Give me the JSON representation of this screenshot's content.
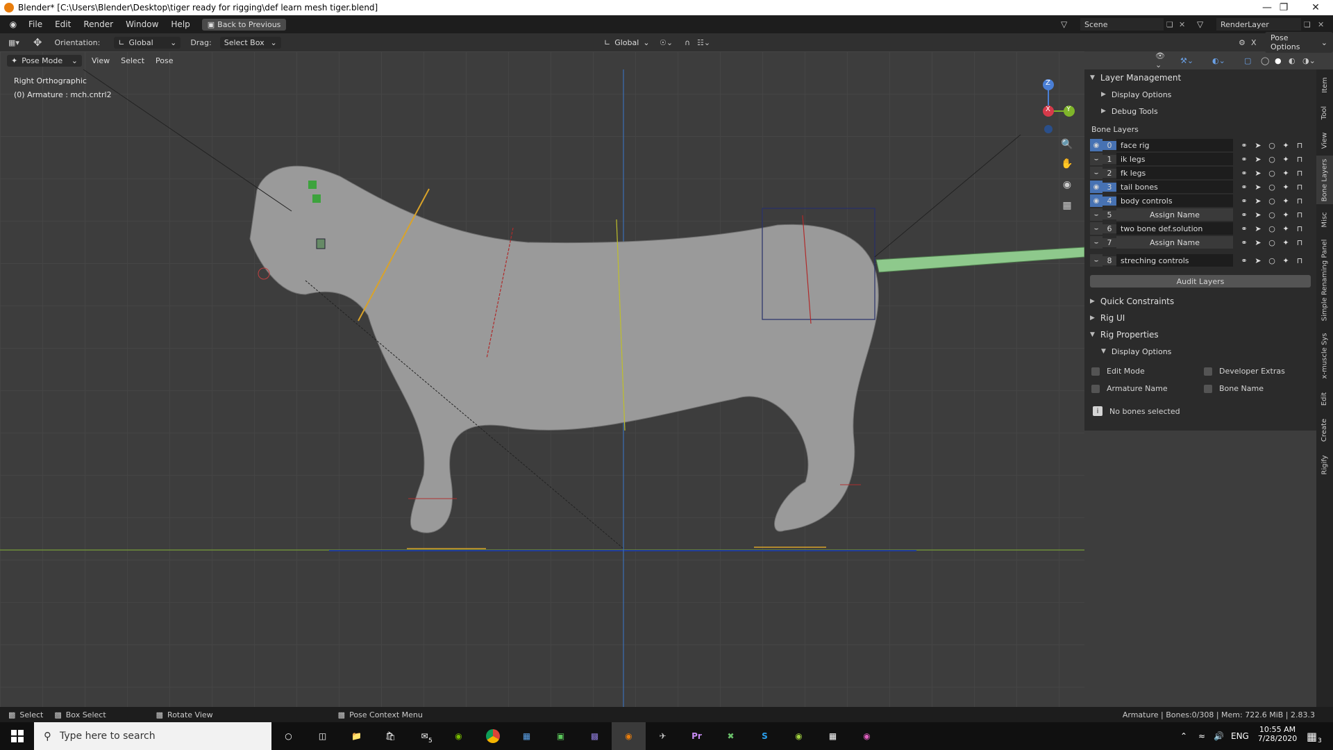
{
  "window": {
    "title": "Blender* [C:\\Users\\Blender\\Desktop\\tiger ready for rigging\\def learn mesh tiger.blend]"
  },
  "menu": {
    "items": [
      "File",
      "Edit",
      "Render",
      "Window",
      "Help"
    ],
    "back_label": "Back to Previous",
    "scene": "Scene",
    "render_layer": "RenderLayer"
  },
  "toolbar": {
    "orientation_label": "Orientation:",
    "orientation_value": "Global",
    "drag_label": "Drag:",
    "drag_value": "Select Box",
    "transform_value": "Global",
    "pose_options": "Pose Options"
  },
  "viewport_header": {
    "mode": "Pose Mode",
    "menus": [
      "View",
      "Select",
      "Pose"
    ]
  },
  "viewport": {
    "view_name": "Right Orthographic",
    "object_info": "(0) Armature : mch.cntrl2",
    "axis_labels": {
      "z": "Z",
      "x": "X",
      "y": "Y"
    }
  },
  "npanel": {
    "layer_management": "Layer Management",
    "display_options": "Display Options",
    "debug_tools": "Debug Tools",
    "bone_layers_title": "Bone Layers",
    "layers": [
      {
        "index": "0",
        "name": "face rig",
        "visible": true,
        "assign": false
      },
      {
        "index": "1",
        "name": "ik legs",
        "visible": false,
        "assign": false
      },
      {
        "index": "2",
        "name": "fk legs",
        "visible": false,
        "assign": false
      },
      {
        "index": "3",
        "name": "tail bones",
        "visible": true,
        "assign": false
      },
      {
        "index": "4",
        "name": "body controls",
        "visible": true,
        "assign": false
      },
      {
        "index": "5",
        "name": "Assign Name",
        "visible": false,
        "assign": true
      },
      {
        "index": "6",
        "name": "two bone def.solution",
        "visible": false,
        "assign": false
      },
      {
        "index": "7",
        "name": "Assign Name",
        "visible": false,
        "assign": true
      },
      {
        "index": "8",
        "name": "streching controls",
        "visible": false,
        "assign": false
      }
    ],
    "audit_layers": "Audit Layers",
    "quick_constraints": "Quick Constraints",
    "rig_ui": "Rig UI",
    "rig_properties": "Rig Properties",
    "rig_display_options": "Display Options",
    "checkboxes": {
      "edit_mode": "Edit Mode",
      "developer_extras": "Developer Extras",
      "armature_name": "Armature Name",
      "bone_name": "Bone Name"
    },
    "no_bones": "No bones selected"
  },
  "side_tabs": [
    "Item",
    "Tool",
    "View",
    "Bone Layers",
    "Misc",
    "Simple Renaming Panel",
    "x-muscle Sys",
    "Edit",
    "Create",
    "Rigify"
  ],
  "status": {
    "select": "Select",
    "box_select": "Box Select",
    "rotate_view": "Rotate View",
    "pose_context": "Pose Context Menu",
    "info": "Armature | Bones:0/308 | Mem: 722.6 MiB | 2.83.3"
  },
  "taskbar": {
    "search_placeholder": "Type here to search",
    "language": "ENG",
    "time": "10:55 AM",
    "date": "7/28/2020",
    "mail_badge": "5",
    "notification_count": "3"
  }
}
